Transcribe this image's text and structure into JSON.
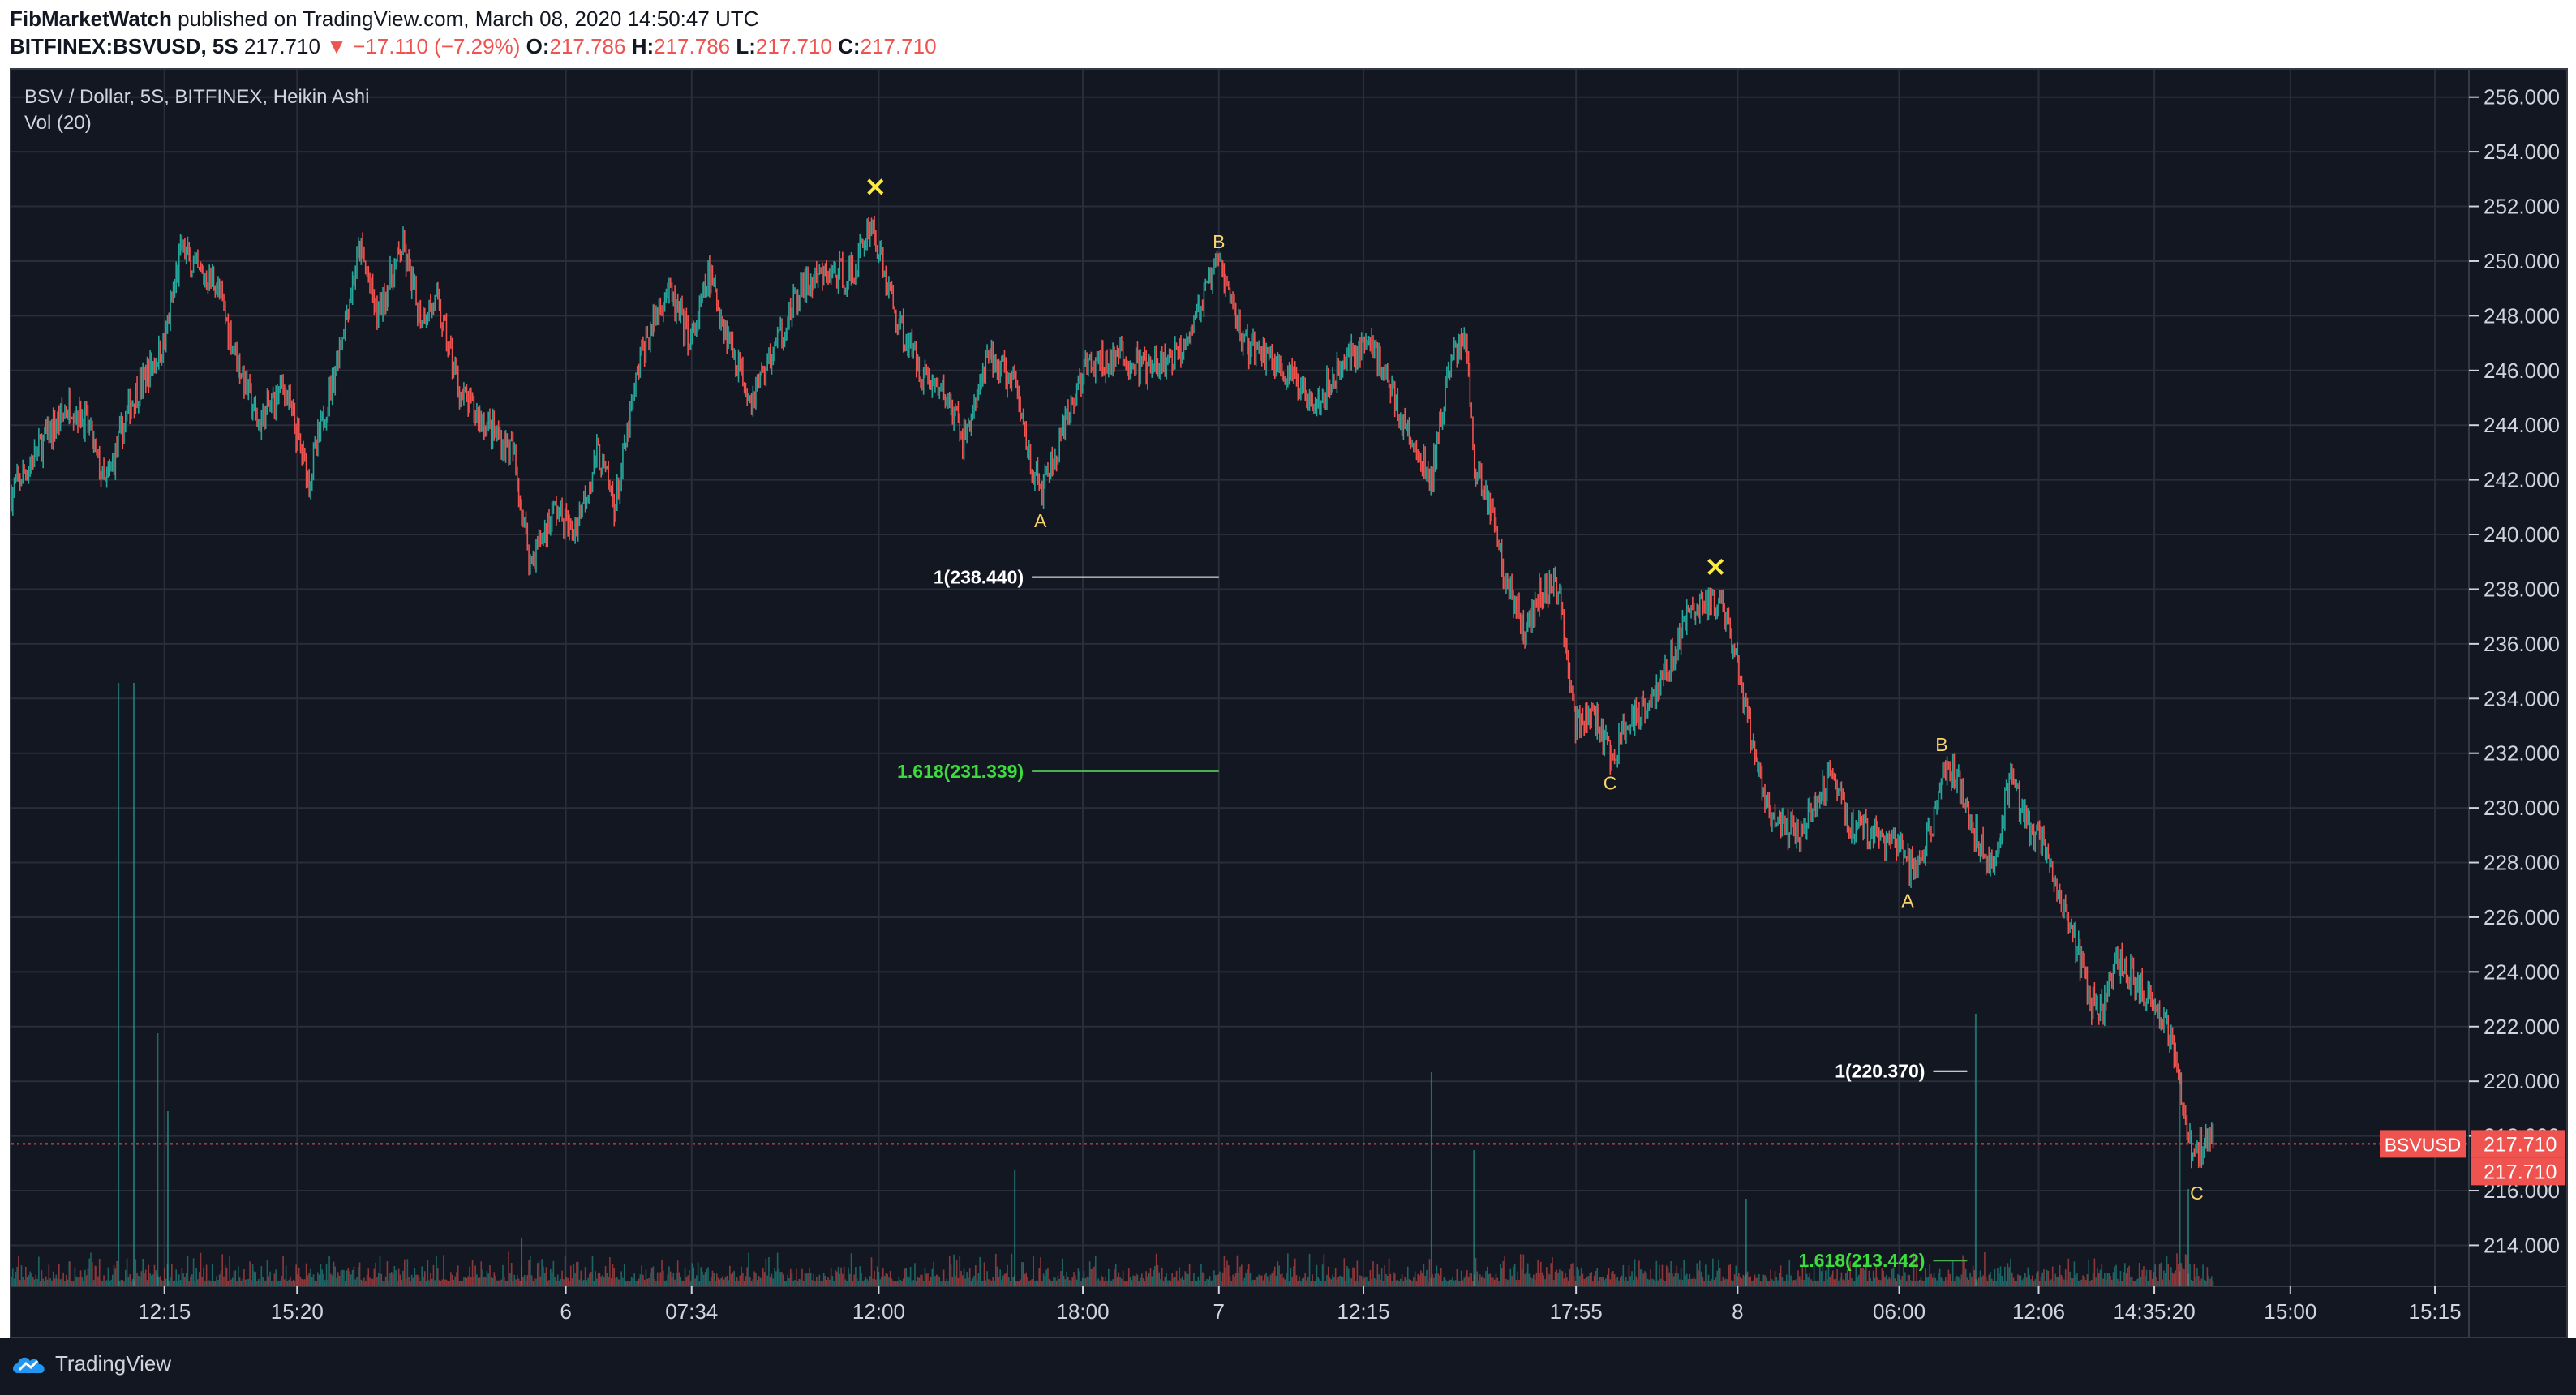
{
  "header": {
    "author": "FibMarketWatch",
    "published_text": " published on TradingView.com, March 08, 2020 14:50:47 UTC",
    "symbol": "BITFINEX:BSVUSD, 5S",
    "last_price": "217.710",
    "change": "▼ −17.110 (−7.29%)",
    "o_label": "O:",
    "o_value": "217.786",
    "h_label": "H:",
    "h_value": "217.786",
    "l_label": "L:",
    "l_value": "217.710",
    "c_label": "C:",
    "c_value": "217.710"
  },
  "legend": {
    "series": "BSV / Dollar, 5S, BITFINEX, Heikin Ashi",
    "volume": "Vol (20)"
  },
  "colors": {
    "background": "#131722",
    "grid": "#2a2e39",
    "up": "#26a69a",
    "down": "#ef5350",
    "axis_text": "#d1d4dc",
    "wave_label": "#f7d56b",
    "x_marker": "#ffeb3b",
    "fib_100": "#ffffff",
    "fib_1618": "#4caf50",
    "fib_1618_text": "#3ddc3d",
    "price_line": "#ef5350"
  },
  "footer": {
    "brand": "TradingView",
    "icon": "tradingview-cloud-icon"
  },
  "chart_data": {
    "type": "candlestick",
    "style": "Heikin Ashi",
    "ylim": [
      212.5,
      257.0
    ],
    "y_ticks": [
      "256.000",
      "254.000",
      "252.000",
      "250.000",
      "248.000",
      "246.000",
      "244.000",
      "242.000",
      "240.000",
      "238.000",
      "236.000",
      "234.000",
      "232.000",
      "230.000",
      "228.000",
      "226.000",
      "224.000",
      "222.000",
      "220.000",
      "218.000",
      "216.000",
      "214.000"
    ],
    "x_ticks": [
      {
        "label": "12:15",
        "t": 0.9
      },
      {
        "label": "15:20",
        "t": 1.68
      },
      {
        "label": "6",
        "t": 3.26
      },
      {
        "label": "07:34",
        "t": 4.0
      },
      {
        "label": "12:00",
        "t": 5.1
      },
      {
        "label": "18:00",
        "t": 6.3
      },
      {
        "label": "7",
        "t": 7.1
      },
      {
        "label": "12:15",
        "t": 7.95
      },
      {
        "label": "17:55",
        "t": 9.2
      },
      {
        "label": "8",
        "t": 10.15
      },
      {
        "label": "06:00",
        "t": 11.1
      },
      {
        "label": "12:06",
        "t": 11.92
      },
      {
        "label": "14:35:20",
        "t": 12.6
      },
      {
        "label": "15:00",
        "t": 13.4
      },
      {
        "label": "15:15",
        "t": 14.25
      }
    ],
    "t_range": [
      0,
      14.45
    ],
    "price_path": [
      [
        0.0,
        241.5
      ],
      [
        0.2,
        243.5
      ],
      [
        0.35,
        244.8
      ],
      [
        0.45,
        244.0
      ],
      [
        0.55,
        241.7
      ],
      [
        0.7,
        244.8
      ],
      [
        0.9,
        247.0
      ],
      [
        1.0,
        250.5
      ],
      [
        1.1,
        249.5
      ],
      [
        1.2,
        249.3
      ],
      [
        1.3,
        247.0
      ],
      [
        1.45,
        244.0
      ],
      [
        1.6,
        245.5
      ],
      [
        1.75,
        242.0
      ],
      [
        1.9,
        246.0
      ],
      [
        2.05,
        250.5
      ],
      [
        2.15,
        248.0
      ],
      [
        2.3,
        250.5
      ],
      [
        2.4,
        248.0
      ],
      [
        2.5,
        248.5
      ],
      [
        2.65,
        245.0
      ],
      [
        2.8,
        244.0
      ],
      [
        2.95,
        243.0
      ],
      [
        3.05,
        239.0
      ],
      [
        3.2,
        241.0
      ],
      [
        3.3,
        240.0
      ],
      [
        3.45,
        243.0
      ],
      [
        3.55,
        241.0
      ],
      [
        3.7,
        246.5
      ],
      [
        3.85,
        249.0
      ],
      [
        4.0,
        247.0
      ],
      [
        4.1,
        249.5
      ],
      [
        4.2,
        247.5
      ],
      [
        4.35,
        245.0
      ],
      [
        4.5,
        247.0
      ],
      [
        4.65,
        249.0
      ],
      [
        4.8,
        249.5
      ],
      [
        4.95,
        249.5
      ],
      [
        5.05,
        251.5
      ],
      [
        5.2,
        248.0
      ],
      [
        5.35,
        246.0
      ],
      [
        5.5,
        245.0
      ],
      [
        5.6,
        243.5
      ],
      [
        5.75,
        246.5
      ],
      [
        5.9,
        245.5
      ],
      [
        6.0,
        242.5
      ],
      [
        6.05,
        241.5
      ],
      [
        6.15,
        243.0
      ],
      [
        6.3,
        246.0
      ],
      [
        6.5,
        246.5
      ],
      [
        6.7,
        246.0
      ],
      [
        6.85,
        246.5
      ],
      [
        7.0,
        248.5
      ],
      [
        7.1,
        250.0
      ],
      [
        7.25,
        247.0
      ],
      [
        7.4,
        246.5
      ],
      [
        7.55,
        245.5
      ],
      [
        7.7,
        245.0
      ],
      [
        7.85,
        246.5
      ],
      [
        8.0,
        247.0
      ],
      [
        8.1,
        245.5
      ],
      [
        8.25,
        243.0
      ],
      [
        8.35,
        242.0
      ],
      [
        8.45,
        246.0
      ],
      [
        8.55,
        247.5
      ],
      [
        8.6,
        242.5
      ],
      [
        8.7,
        241.0
      ],
      [
        8.8,
        238.0
      ],
      [
        8.9,
        236.5
      ],
      [
        9.0,
        238.0
      ],
      [
        9.1,
        238.0
      ],
      [
        9.2,
        233.0
      ],
      [
        9.3,
        233.5
      ],
      [
        9.4,
        231.8
      ],
      [
        9.55,
        233.5
      ],
      [
        9.7,
        234.5
      ],
      [
        9.85,
        237.0
      ],
      [
        9.95,
        237.5
      ],
      [
        10.05,
        237.5
      ],
      [
        10.15,
        235.0
      ],
      [
        10.25,
        232.0
      ],
      [
        10.35,
        229.5
      ],
      [
        10.5,
        229.0
      ],
      [
        10.6,
        230.0
      ],
      [
        10.7,
        231.5
      ],
      [
        10.8,
        229.5
      ],
      [
        10.95,
        229.0
      ],
      [
        11.1,
        228.5
      ],
      [
        11.2,
        227.5
      ],
      [
        11.3,
        229.5
      ],
      [
        11.35,
        231.5
      ],
      [
        11.45,
        231.0
      ],
      [
        11.55,
        229.0
      ],
      [
        11.65,
        228.0
      ],
      [
        11.75,
        231.0
      ],
      [
        11.85,
        229.5
      ],
      [
        11.95,
        228.5
      ],
      [
        12.05,
        226.5
      ],
      [
        12.12,
        225.5
      ],
      [
        12.22,
        223.0
      ],
      [
        12.3,
        222.5
      ],
      [
        12.38,
        224.5
      ],
      [
        12.5,
        223.5
      ],
      [
        12.6,
        223.0
      ],
      [
        12.68,
        222.0
      ],
      [
        12.75,
        220.0
      ],
      [
        12.82,
        217.2
      ],
      [
        12.9,
        217.8
      ],
      [
        12.95,
        217.71
      ]
    ],
    "volume_spikes": [
      [
        0.63,
        0.62
      ],
      [
        0.72,
        0.62
      ],
      [
        0.86,
        0.26
      ],
      [
        0.92,
        0.18
      ],
      [
        3.0,
        0.05
      ],
      [
        5.9,
        0.12
      ],
      [
        8.35,
        0.22
      ],
      [
        8.6,
        0.14
      ],
      [
        10.2,
        0.09
      ],
      [
        11.55,
        0.28
      ],
      [
        12.75,
        0.22
      ],
      [
        12.8,
        0.1
      ]
    ],
    "wave_labels": [
      {
        "text": "A",
        "t": 6.05,
        "price": 241.4,
        "pos": "below"
      },
      {
        "text": "B",
        "t": 7.1,
        "price": 250.0,
        "pos": "above"
      },
      {
        "text": "C",
        "t": 9.4,
        "price": 231.8,
        "pos": "below"
      },
      {
        "text": "B",
        "t": 11.35,
        "price": 231.6,
        "pos": "above"
      },
      {
        "text": "A",
        "t": 11.15,
        "price": 227.5,
        "pos": "below"
      },
      {
        "text": "C",
        "t": 12.85,
        "price": 216.8,
        "pos": "below"
      }
    ],
    "x_markers": [
      {
        "text": "×",
        "t": 5.08,
        "price": 252.4
      },
      {
        "text": "×",
        "t": 10.02,
        "price": 238.5
      }
    ],
    "fib_levels": [
      {
        "label": "1(238.440)",
        "price": 238.44,
        "t_start": 6.0,
        "t_end": 7.1,
        "kind": "fib_100"
      },
      {
        "label": "1.618(231.339)",
        "price": 231.339,
        "t_start": 6.0,
        "t_end": 7.1,
        "kind": "fib_1618"
      },
      {
        "label": "1(220.370)",
        "price": 220.37,
        "t_start": 11.3,
        "t_end": 11.5,
        "kind": "fib_100"
      },
      {
        "label": "1.618(213.442)",
        "price": 213.442,
        "t_start": 11.3,
        "t_end": 11.5,
        "kind": "fib_1618"
      }
    ],
    "last_price": 217.71,
    "symbol_tag": "BSVUSD",
    "last_price_label": "217.710"
  }
}
